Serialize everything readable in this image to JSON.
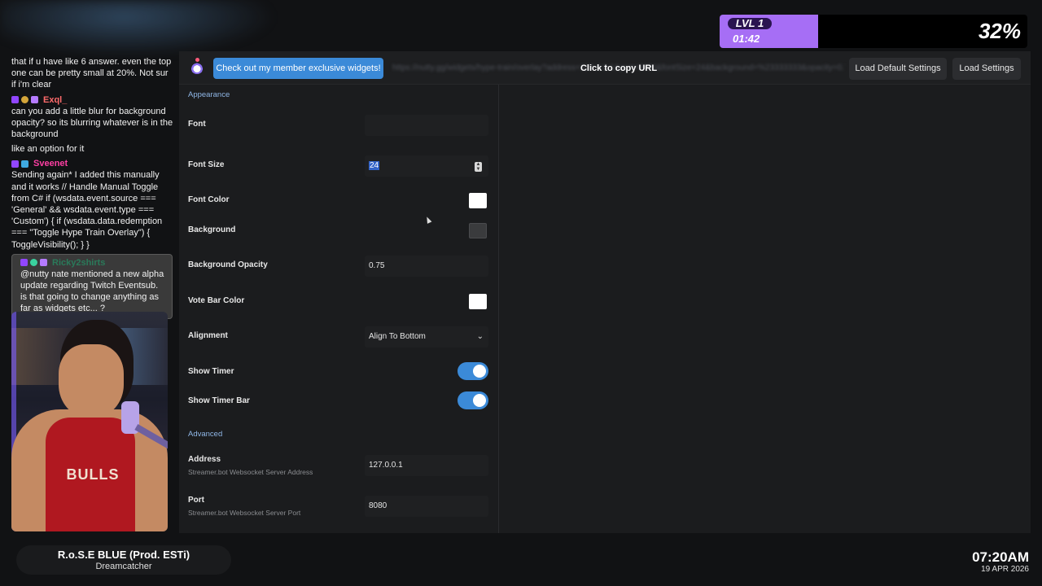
{
  "hype_train": {
    "level": "LVL 1",
    "timer": "01:42",
    "percent": "32%",
    "progress_fraction": 0.32
  },
  "chat": {
    "messages": [
      {
        "user": "",
        "text": "that if u have like 6 answer. even the top one can be pretty small at 20%. Not sur if i'm clear"
      },
      {
        "user": "Exql_",
        "user_color": "#ff6b6b",
        "text": "can you add a little blur for background opacity? so its blurring whatever is in the background"
      },
      {
        "user": "",
        "text": "like an option for it"
      },
      {
        "user": "Sveenet",
        "user_color": "#ff3fa4",
        "text": "Sending again* I added this manually and it works // Handle Manual Toggle from C# if (wsdata.event.source === 'General' && wsdata.event.type === 'Custom') { if (wsdata.data.redemption === \"Toggle Hype Train Overlay\") { ToggleVisibility(); } }"
      },
      {
        "user": "Ricky2shirts",
        "user_color": "#2a7a5a",
        "text": "@nutty nate mentioned a new alpha update regarding Twitch Eventsub. is that going to change anything as far as widgets etc... ?"
      }
    ]
  },
  "webcam": {
    "jersey_text": "BULLS"
  },
  "now_playing": {
    "title": "R.o.S.E BLUE (Prod. ESTi)",
    "artist": "Dreamcatcher"
  },
  "clock": {
    "time": "07:20AM",
    "date": "19 APR 2026"
  },
  "toolbar": {
    "promo_label": "Check out my member exclusive widgets!",
    "url_hint": "Click to copy URL",
    "url_value": "https://nutty.gg/widgets/hype-train/overlay?address=127.0.0.1&port=8080&fontSize=24&background=%23333333&opacity=0.75&align=bottom",
    "load_default_label": "Load Default Settings",
    "load_settings_label": "Load Settings"
  },
  "settings": {
    "appearance_header": "Appearance",
    "font_label": "Font",
    "font_value": "",
    "font_size_label": "Font Size",
    "font_size_value": "24",
    "font_color_label": "Font Color",
    "font_color": "#ffffff",
    "background_label": "Background",
    "background_color": "#3a3b3d",
    "background_opacity_label": "Background Opacity",
    "background_opacity_value": "0.75",
    "vote_bar_color_label": "Vote Bar Color",
    "vote_bar_color": "#ffffff",
    "alignment_label": "Alignment",
    "alignment_value": "Align To Bottom",
    "show_timer_label": "Show Timer",
    "show_timer": true,
    "show_timer_bar_label": "Show Timer Bar",
    "show_timer_bar": true,
    "advanced_header": "Advanced",
    "address_label": "Address",
    "address_sub": "Streamer.bot Websocket Server Address",
    "address_value": "127.0.0.1",
    "port_label": "Port",
    "port_sub": "Streamer.bot Websocket Server Port",
    "port_value": "8080"
  },
  "colors": {
    "accent": "#3b8ad8",
    "hype_purple": "#a66ef5"
  }
}
